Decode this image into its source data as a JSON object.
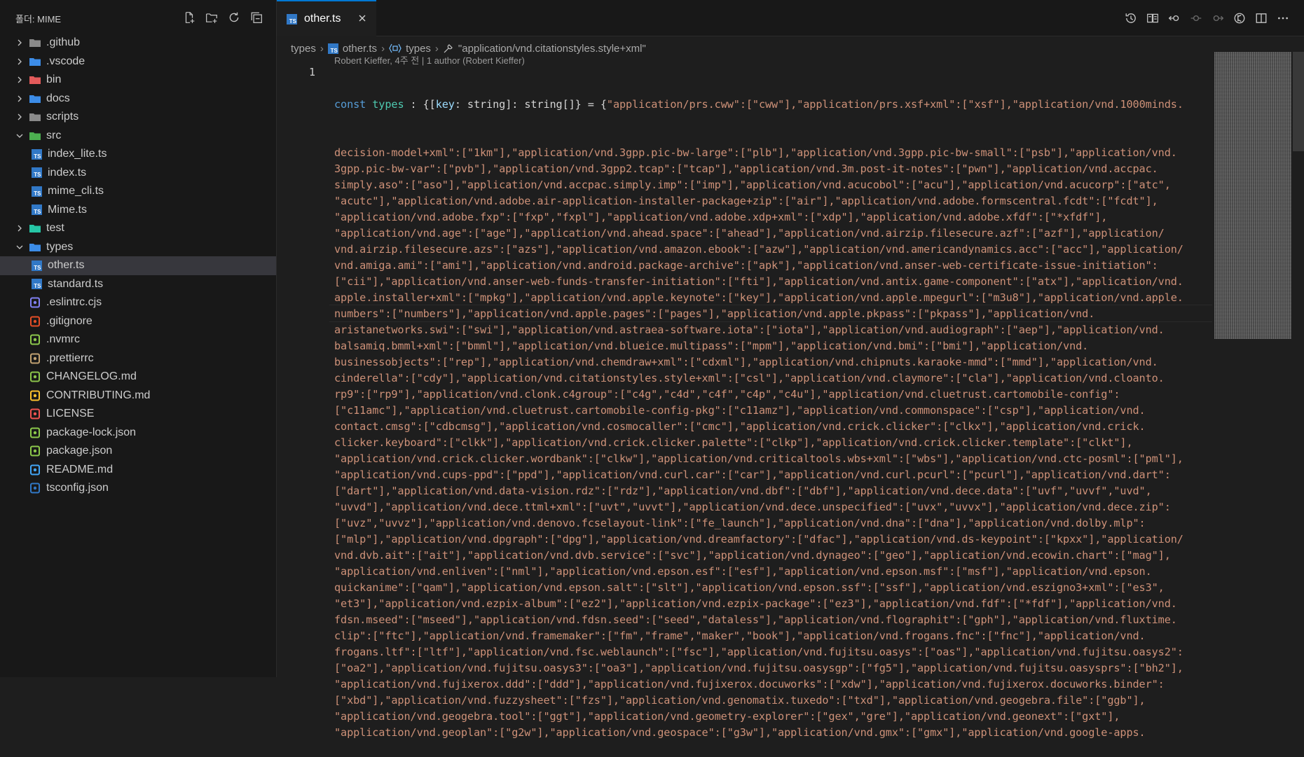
{
  "sidebar": {
    "title": "폴더: MIME",
    "actions": [
      "new-file-icon",
      "new-folder-icon",
      "refresh-icon",
      "collapse-all-icon"
    ],
    "items": [
      {
        "label": ".github",
        "kind": "folder",
        "expanded": false,
        "icon": "github-folder-icon",
        "color": "#8a8a8a",
        "depth": 0
      },
      {
        "label": ".vscode",
        "kind": "folder",
        "expanded": false,
        "icon": "vscode-folder-icon",
        "color": "#3c8ce7",
        "depth": 0
      },
      {
        "label": "bin",
        "kind": "folder",
        "expanded": false,
        "icon": "bin-folder-icon",
        "color": "#e35b5b",
        "depth": 0
      },
      {
        "label": "docs",
        "kind": "folder",
        "expanded": false,
        "icon": "docs-folder-icon",
        "color": "#3c8ce7",
        "depth": 0
      },
      {
        "label": "scripts",
        "kind": "folder",
        "expanded": false,
        "icon": "scripts-folder-icon",
        "color": "#8a8a8a",
        "depth": 0
      },
      {
        "label": "src",
        "kind": "folder",
        "expanded": true,
        "icon": "src-folder-icon",
        "color": "#4caf50",
        "depth": 0
      },
      {
        "label": "index_lite.ts",
        "kind": "ts",
        "depth": 1
      },
      {
        "label": "index.ts",
        "kind": "ts",
        "depth": 1
      },
      {
        "label": "mime_cli.ts",
        "kind": "ts",
        "depth": 1
      },
      {
        "label": "Mime.ts",
        "kind": "ts",
        "depth": 1
      },
      {
        "label": "test",
        "kind": "folder",
        "expanded": false,
        "icon": "test-folder-icon",
        "color": "#26c6a6",
        "depth": 0
      },
      {
        "label": "types",
        "kind": "folder",
        "expanded": true,
        "icon": "types-folder-icon",
        "color": "#3c8ce7",
        "depth": 0
      },
      {
        "label": "other.ts",
        "kind": "ts",
        "depth": 1,
        "selected": true
      },
      {
        "label": "standard.ts",
        "kind": "ts",
        "depth": 1
      },
      {
        "label": ".eslintrc.cjs",
        "kind": "file",
        "icon": "eslint-icon",
        "color": "#8080f2",
        "depth": 0
      },
      {
        "label": ".gitignore",
        "kind": "file",
        "icon": "git-icon",
        "color": "#e44d26",
        "depth": 0
      },
      {
        "label": ".nvmrc",
        "kind": "file",
        "icon": "node-icon",
        "color": "#8cc84b",
        "depth": 0
      },
      {
        "label": ".prettierrc",
        "kind": "file",
        "icon": "prettier-icon",
        "color": "#c0a070",
        "depth": 0
      },
      {
        "label": "CHANGELOG.md",
        "kind": "file",
        "icon": "changelog-icon",
        "color": "#8bc34a",
        "depth": 0
      },
      {
        "label": "CONTRIBUTING.md",
        "kind": "file",
        "icon": "contributing-icon",
        "color": "#fbc02d",
        "depth": 0
      },
      {
        "label": "LICENSE",
        "kind": "file",
        "icon": "license-icon",
        "color": "#ef5350",
        "depth": 0
      },
      {
        "label": "package-lock.json",
        "kind": "file",
        "icon": "npm-icon",
        "color": "#8cc84b",
        "depth": 0
      },
      {
        "label": "package.json",
        "kind": "file",
        "icon": "npm-icon",
        "color": "#8cc84b",
        "depth": 0
      },
      {
        "label": "README.md",
        "kind": "file",
        "icon": "info-icon",
        "color": "#42a5f5",
        "depth": 0
      },
      {
        "label": "tsconfig.json",
        "kind": "file",
        "icon": "tsconfig-icon",
        "color": "#3178c6",
        "depth": 0
      }
    ]
  },
  "tab": {
    "label": "other.ts",
    "icon": "ts-file-icon",
    "accent": "#0078d4"
  },
  "editor_actions": [
    "timeline-icon",
    "compare-changes-icon",
    "revert-icon",
    "previous-change-icon",
    "next-change-icon",
    "open-changes-icon",
    "split-editor-icon",
    "more-actions-icon"
  ],
  "breadcrumb": {
    "folder": "types",
    "file": "other.ts",
    "symbol": "types",
    "property": "\"application/vnd.citationstyles.style+xml\""
  },
  "blame": "Robert Kieffer, 4주 전 | 1 author (Robert Kieffer)",
  "gutter": {
    "line_number": "1"
  },
  "code": {
    "first_line_prefix": "const ",
    "first_line_var": "types",
    "first_line_mid": " : {[",
    "first_line_key": "key",
    "first_line_type": ": string]: string[]} = {",
    "first_line_rest": "\"application/prs.cww\":[\"cww\"],\"application/prs.xsf+xml\":[\"xsf\"],\"application/vnd.1000minds.",
    "lines": [
      "decision-model+xml\":[\"1km\"],\"application/vnd.3gpp.pic-bw-large\":[\"plb\"],\"application/vnd.3gpp.pic-bw-small\":[\"psb\"],\"application/vnd.",
      "3gpp.pic-bw-var\":[\"pvb\"],\"application/vnd.3gpp2.tcap\":[\"tcap\"],\"application/vnd.3m.post-it-notes\":[\"pwn\"],\"application/vnd.accpac.",
      "simply.aso\":[\"aso\"],\"application/vnd.accpac.simply.imp\":[\"imp\"],\"application/vnd.acucobol\":[\"acu\"],\"application/vnd.acucorp\":[\"atc\",",
      "\"acutc\"],\"application/vnd.adobe.air-application-installer-package+zip\":[\"air\"],\"application/vnd.adobe.formscentral.fcdt\":[\"fcdt\"],",
      "\"application/vnd.adobe.fxp\":[\"fxp\",\"fxpl\"],\"application/vnd.adobe.xdp+xml\":[\"xdp\"],\"application/vnd.adobe.xfdf\":[\"*xfdf\"],",
      "\"application/vnd.age\":[\"age\"],\"application/vnd.ahead.space\":[\"ahead\"],\"application/vnd.airzip.filesecure.azf\":[\"azf\"],\"application/",
      "vnd.airzip.filesecure.azs\":[\"azs\"],\"application/vnd.amazon.ebook\":[\"azw\"],\"application/vnd.americandynamics.acc\":[\"acc\"],\"application/",
      "vnd.amiga.ami\":[\"ami\"],\"application/vnd.android.package-archive\":[\"apk\"],\"application/vnd.anser-web-certificate-issue-initiation\":",
      "[\"cii\"],\"application/vnd.anser-web-funds-transfer-initiation\":[\"fti\"],\"application/vnd.antix.game-component\":[\"atx\"],\"application/vnd.",
      "apple.installer+xml\":[\"mpkg\"],\"application/vnd.apple.keynote\":[\"key\"],\"application/vnd.apple.mpegurl\":[\"m3u8\"],\"application/vnd.apple.",
      "numbers\":[\"numbers\"],\"application/vnd.apple.pages\":[\"pages\"],\"application/vnd.apple.pkpass\":[\"pkpass\"],\"application/vnd.",
      "aristanetworks.swi\":[\"swi\"],\"application/vnd.astraea-software.iota\":[\"iota\"],\"application/vnd.audiograph\":[\"aep\"],\"application/vnd.",
      "balsamiq.bmml+xml\":[\"bmml\"],\"application/vnd.blueice.multipass\":[\"mpm\"],\"application/vnd.bmi\":[\"bmi\"],\"application/vnd.",
      "businessobjects\":[\"rep\"],\"application/vnd.chemdraw+xml\":[\"cdxml\"],\"application/vnd.chipnuts.karaoke-mmd\":[\"mmd\"],\"application/vnd.",
      "cinderella\":[\"cdy\"],\"application/vnd.citationstyles.style+xml\":[\"csl\"],\"application/vnd.claymore\":[\"cla\"],\"application/vnd.cloanto.",
      "rp9\":[\"rp9\"],\"application/vnd.clonk.c4group\":[\"c4g\",\"c4d\",\"c4f\",\"c4p\",\"c4u\"],\"application/vnd.cluetrust.cartomobile-config\":",
      "[\"c11amc\"],\"application/vnd.cluetrust.cartomobile-config-pkg\":[\"c11amz\"],\"application/vnd.commonspace\":[\"csp\"],\"application/vnd.",
      "contact.cmsg\":[\"cdbcmsg\"],\"application/vnd.cosmocaller\":[\"cmc\"],\"application/vnd.crick.clicker\":[\"clkx\"],\"application/vnd.crick.",
      "clicker.keyboard\":[\"clkk\"],\"application/vnd.crick.clicker.palette\":[\"clkp\"],\"application/vnd.crick.clicker.template\":[\"clkt\"],",
      "\"application/vnd.crick.clicker.wordbank\":[\"clkw\"],\"application/vnd.criticaltools.wbs+xml\":[\"wbs\"],\"application/vnd.ctc-posml\":[\"pml\"],",
      "\"application/vnd.cups-ppd\":[\"ppd\"],\"application/vnd.curl.car\":[\"car\"],\"application/vnd.curl.pcurl\":[\"pcurl\"],\"application/vnd.dart\":",
      "[\"dart\"],\"application/vnd.data-vision.rdz\":[\"rdz\"],\"application/vnd.dbf\":[\"dbf\"],\"application/vnd.dece.data\":[\"uvf\",\"uvvf\",\"uvd\",",
      "\"uvvd\"],\"application/vnd.dece.ttml+xml\":[\"uvt\",\"uvvt\"],\"application/vnd.dece.unspecified\":[\"uvx\",\"uvvx\"],\"application/vnd.dece.zip\":",
      "[\"uvz\",\"uvvz\"],\"application/vnd.denovo.fcselayout-link\":[\"fe_launch\"],\"application/vnd.dna\":[\"dna\"],\"application/vnd.dolby.mlp\":",
      "[\"mlp\"],\"application/vnd.dpgraph\":[\"dpg\"],\"application/vnd.dreamfactory\":[\"dfac\"],\"application/vnd.ds-keypoint\":[\"kpxx\"],\"application/",
      "vnd.dvb.ait\":[\"ait\"],\"application/vnd.dvb.service\":[\"svc\"],\"application/vnd.dynageo\":[\"geo\"],\"application/vnd.ecowin.chart\":[\"mag\"],",
      "\"application/vnd.enliven\":[\"nml\"],\"application/vnd.epson.esf\":[\"esf\"],\"application/vnd.epson.msf\":[\"msf\"],\"application/vnd.epson.",
      "quickanime\":[\"qam\"],\"application/vnd.epson.salt\":[\"slt\"],\"application/vnd.epson.ssf\":[\"ssf\"],\"application/vnd.eszigno3+xml\":[\"es3\",",
      "\"et3\"],\"application/vnd.ezpix-album\":[\"ez2\"],\"application/vnd.ezpix-package\":[\"ez3\"],\"application/vnd.fdf\":[\"*fdf\"],\"application/vnd.",
      "fdsn.mseed\":[\"mseed\"],\"application/vnd.fdsn.seed\":[\"seed\",\"dataless\"],\"application/vnd.flographit\":[\"gph\"],\"application/vnd.fluxtime.",
      "clip\":[\"ftc\"],\"application/vnd.framemaker\":[\"fm\",\"frame\",\"maker\",\"book\"],\"application/vnd.frogans.fnc\":[\"fnc\"],\"application/vnd.",
      "frogans.ltf\":[\"ltf\"],\"application/vnd.fsc.weblaunch\":[\"fsc\"],\"application/vnd.fujitsu.oasys\":[\"oas\"],\"application/vnd.fujitsu.oasys2\":",
      "[\"oa2\"],\"application/vnd.fujitsu.oasys3\":[\"oa3\"],\"application/vnd.fujitsu.oasysgp\":[\"fg5\"],\"application/vnd.fujitsu.oasysprs\":[\"bh2\"],",
      "\"application/vnd.fujixerox.ddd\":[\"ddd\"],\"application/vnd.fujixerox.docuworks\":[\"xdw\"],\"application/vnd.fujixerox.docuworks.binder\":",
      "[\"xbd\"],\"application/vnd.fuzzysheet\":[\"fzs\"],\"application/vnd.genomatix.tuxedo\":[\"txd\"],\"application/vnd.geogebra.file\":[\"ggb\"],",
      "\"application/vnd.geogebra.tool\":[\"ggt\"],\"application/vnd.geometry-explorer\":[\"gex\",\"gre\"],\"application/vnd.geonext\":[\"gxt\"],",
      "\"application/vnd.geoplan\":[\"g2w\"],\"application/vnd.geospace\":[\"g3w\"],\"application/vnd.gmx\":[\"gmx\"],\"application/vnd.google-apps."
    ]
  }
}
